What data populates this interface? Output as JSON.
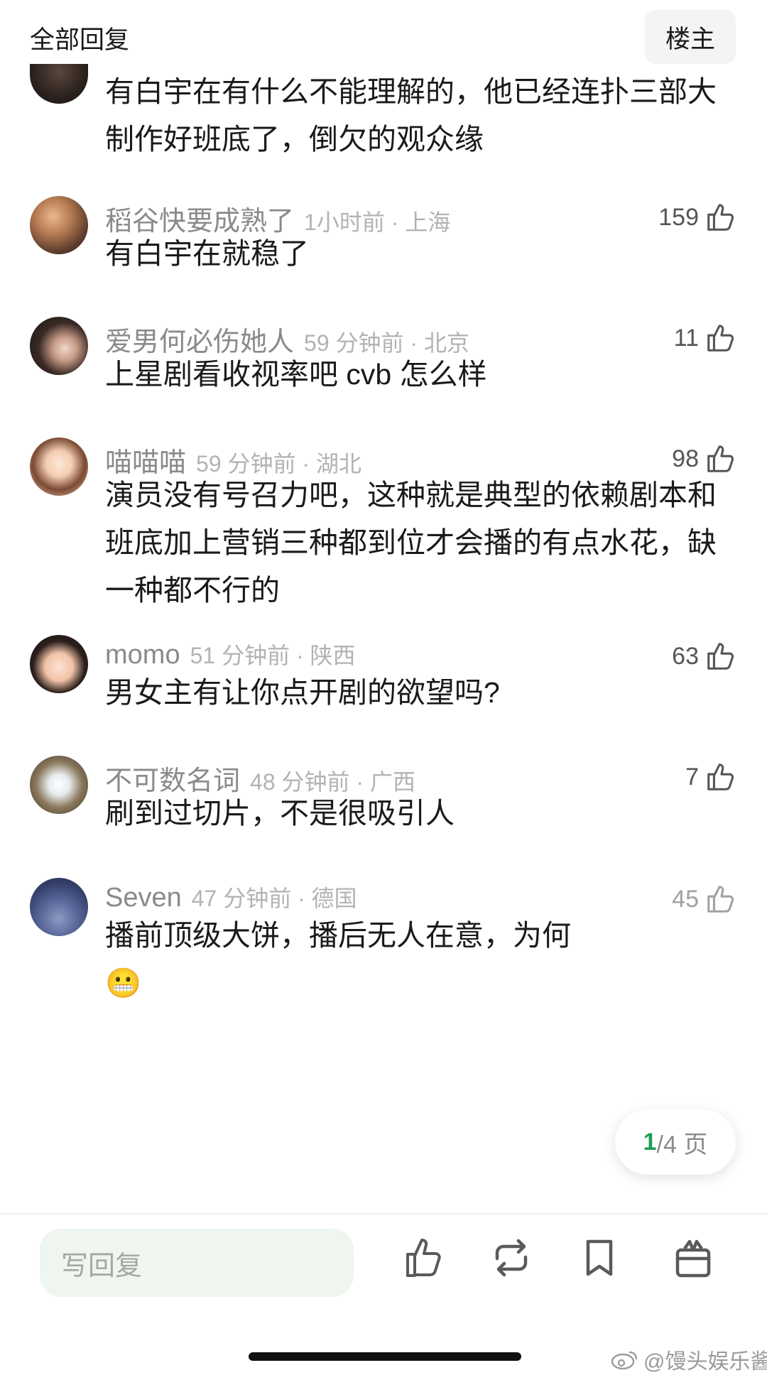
{
  "header": {
    "title": "全部回复",
    "op_button": "楼主"
  },
  "comments": [
    {
      "username": "",
      "time_location": "",
      "likes": "",
      "text": "有白宇在有什么不能理解的，他已经连扑三部大制作好班底了，倒欠的观众缘"
    },
    {
      "username": "稻谷快要成熟了",
      "time_location": "1小时前 · 上海",
      "likes": "159",
      "text": "有白宇在就稳了"
    },
    {
      "username": "爱男何必伤她人",
      "time_location": "59 分钟前 · 北京",
      "likes": "11",
      "text": "上星剧看收视率吧 cvb 怎么样"
    },
    {
      "username": "喵喵喵",
      "time_location": "59 分钟前 · 湖北",
      "likes": "98",
      "text": "演员没有号召力吧，这种就是典型的依赖剧本和班底加上营销三种都到位才会播的有点水花，缺一种都不行的"
    },
    {
      "username": "momo",
      "time_location": "51 分钟前 · 陕西",
      "likes": "63",
      "text": "男女主有让你点开剧的欲望吗?"
    },
    {
      "username": "不可数名词",
      "time_location": "48 分钟前 · 广西",
      "likes": "7",
      "text": "刷到过切片，不是很吸引人"
    },
    {
      "username": "Seven",
      "time_location": "47 分钟前 · 德国",
      "likes": "45",
      "text": "播前顶级大饼，播后无人在意，为何",
      "emoji": "😬"
    }
  ],
  "pagination": {
    "current": "1",
    "total": "/4 页"
  },
  "bottom_bar": {
    "reply_placeholder": "写回复"
  },
  "watermark": {
    "text": "@馒头娱乐酱"
  },
  "colors": {
    "accent": "#1f9d55",
    "meta_gray": "#8a8a8a",
    "reply_bg": "#eef6ef"
  },
  "icons": [
    "thumbs-up-icon",
    "repost-icon",
    "bookmark-icon",
    "gift-icon",
    "weibo-icon"
  ]
}
